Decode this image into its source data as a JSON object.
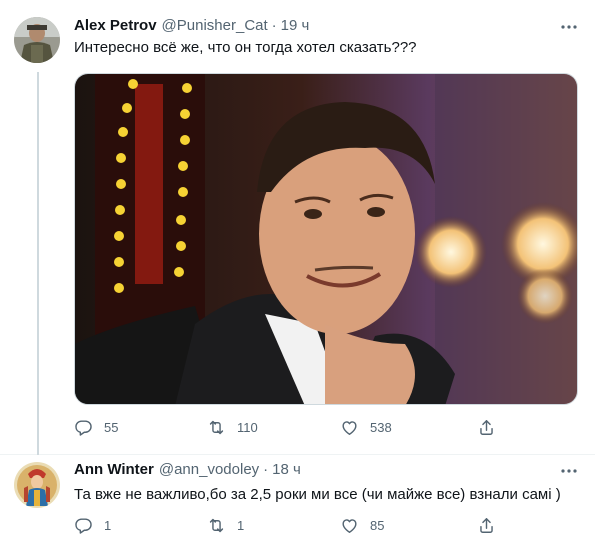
{
  "tweets": [
    {
      "author_name": "Alex Petrov",
      "handle": "@Punisher_Cat",
      "separator": "·",
      "time": "19 ч",
      "text": "Интересно всё же, что он тогда хотел сказать???",
      "replies": "55",
      "retweets": "110",
      "likes": "538",
      "media": "photo"
    },
    {
      "author_name": "Ann Winter",
      "handle": "@ann_vodoley",
      "separator": "·",
      "time": "18 ч",
      "text": "Та вже не важливо,бо за 2,5 роки ми все (чи майже все) взнали самі )",
      "replies": "1",
      "retweets": "1",
      "likes": "85"
    }
  ],
  "colors": {
    "text": "#0f1419",
    "secondary": "#536471",
    "border": "#cfd9de"
  },
  "icons": [
    "more-icon",
    "reply-icon",
    "retweet-icon",
    "like-icon",
    "share-icon"
  ]
}
